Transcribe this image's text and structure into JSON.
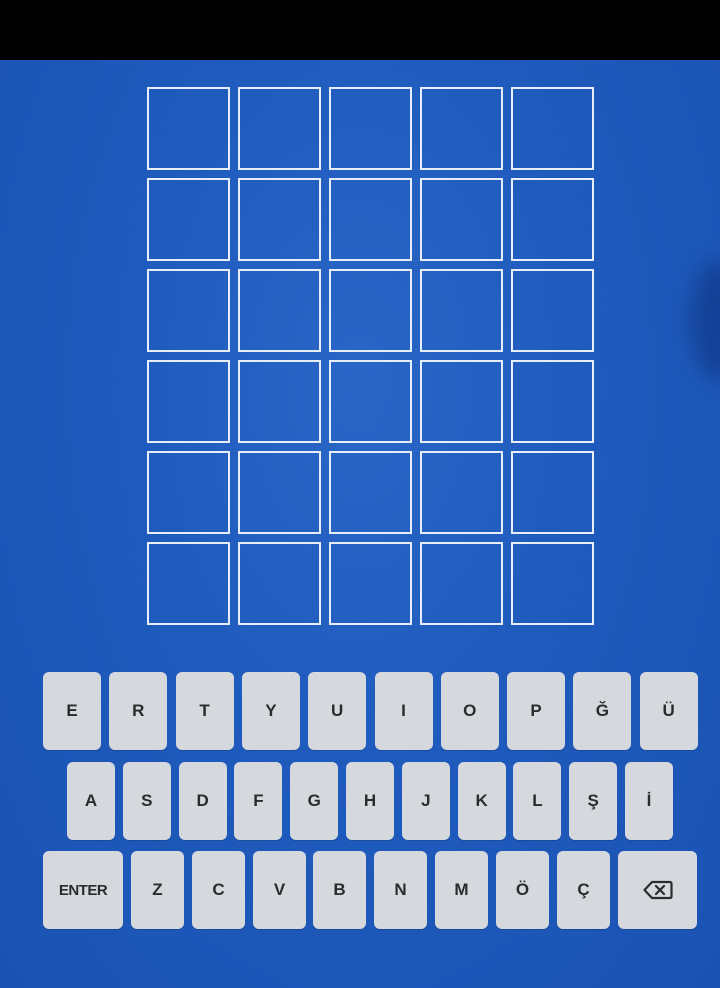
{
  "board": {
    "rows": 6,
    "cols": 5,
    "tiles": [
      [
        "",
        "",
        "",
        "",
        ""
      ],
      [
        "",
        "",
        "",
        "",
        ""
      ],
      [
        "",
        "",
        "",
        "",
        ""
      ],
      [
        "",
        "",
        "",
        "",
        ""
      ],
      [
        "",
        "",
        "",
        "",
        ""
      ],
      [
        "",
        "",
        "",
        "",
        ""
      ]
    ]
  },
  "keyboard": {
    "rows": [
      [
        "E",
        "R",
        "T",
        "Y",
        "U",
        "I",
        "O",
        "P",
        "Ğ",
        "Ü"
      ],
      [
        "A",
        "S",
        "D",
        "F",
        "G",
        "H",
        "J",
        "K",
        "L",
        "Ş",
        "İ"
      ],
      [
        "ENTER",
        "Z",
        "C",
        "V",
        "B",
        "N",
        "M",
        "Ö",
        "Ç",
        "BACKSPACE"
      ]
    ],
    "enter_label": "ENTER",
    "backspace_icon": "backspace-icon"
  },
  "colors": {
    "background": "#1f5bbd",
    "tile_border": "#e8eef9",
    "key_background": "#d5d9de",
    "key_text": "#2b2b2b",
    "top_bar": "#000000"
  }
}
